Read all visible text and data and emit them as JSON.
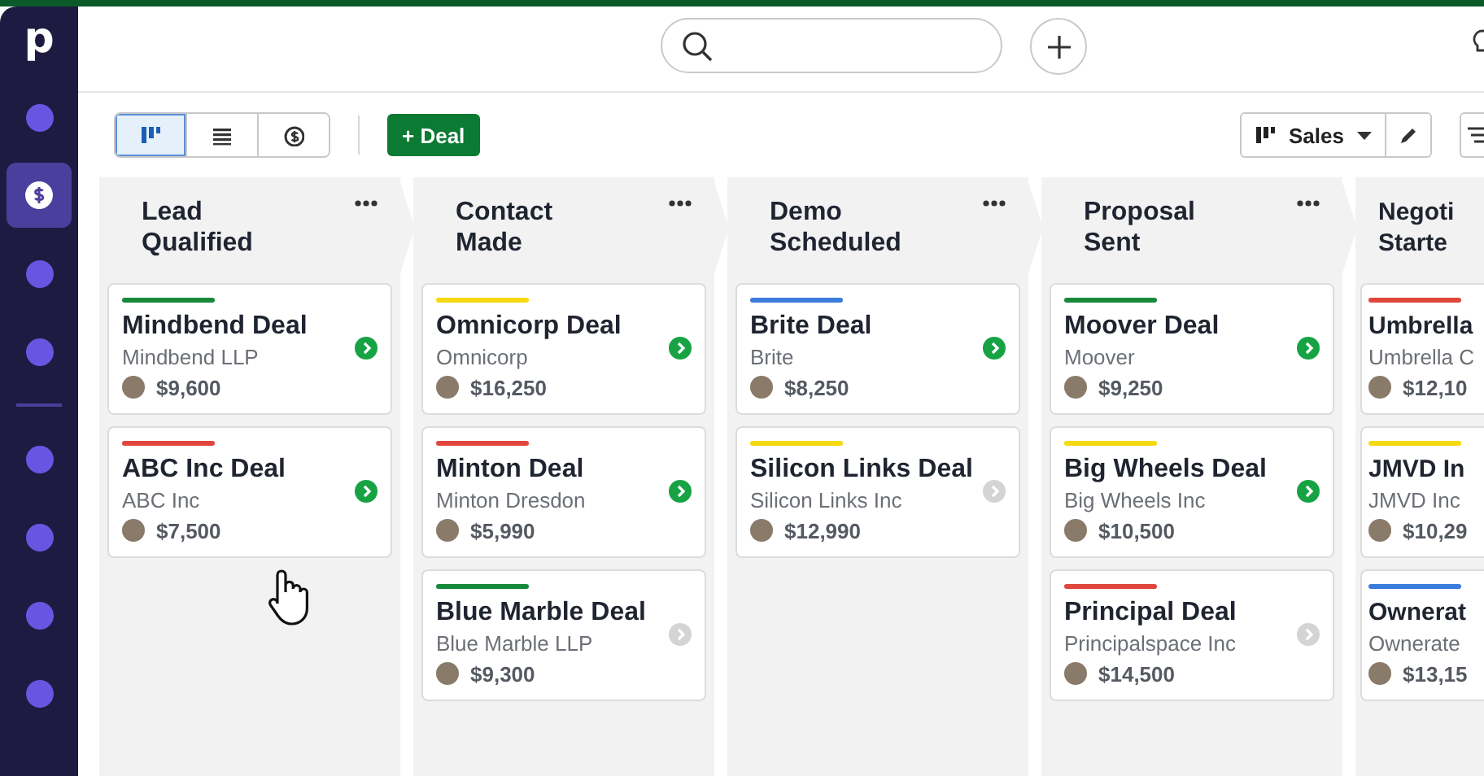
{
  "sidebar": {
    "logo": "p",
    "items": [
      {
        "kind": "dot",
        "selected": false
      },
      {
        "kind": "deals",
        "selected": true
      },
      {
        "kind": "dot",
        "selected": false
      },
      {
        "kind": "dot",
        "selected": false
      },
      {
        "kind": "divider"
      },
      {
        "kind": "dot",
        "selected": false
      },
      {
        "kind": "dot",
        "selected": false
      },
      {
        "kind": "dot",
        "selected": false
      },
      {
        "kind": "dot",
        "selected": false
      }
    ]
  },
  "toolbar": {
    "views": [
      {
        "kind": "pipeline",
        "selected": true
      },
      {
        "kind": "list",
        "selected": false
      },
      {
        "kind": "forecast",
        "selected": false
      }
    ],
    "add_button": "+ Deal",
    "pipeline_select": "Sales"
  },
  "columns": [
    {
      "title": "Lead Qualified",
      "menu": true,
      "cards": [
        {
          "title": "Mindbend Deal",
          "org": "Mindbend LLP",
          "value": "$9,600",
          "color": "#168a3a",
          "active": true
        },
        {
          "title": "ABC Inc Deal",
          "org": "ABC Inc",
          "value": "$7,500",
          "color": "#e0463c",
          "active": true
        }
      ]
    },
    {
      "title": "Contact Made",
      "menu": true,
      "cards": [
        {
          "title": "Omnicorp Deal",
          "org": "Omnicorp",
          "value": "$16,250",
          "color": "#f6d90f",
          "active": true
        },
        {
          "title": "Minton Deal",
          "org": "Minton Dresdon",
          "value": "$5,990",
          "color": "#e0463c",
          "active": true
        },
        {
          "title": "Blue Marble Deal",
          "org": "Blue Marble LLP",
          "value": "$9,300",
          "color": "#168a3a",
          "active": false
        }
      ]
    },
    {
      "title": "Demo Scheduled",
      "menu": true,
      "cards": [
        {
          "title": "Brite Deal",
          "org": "Brite",
          "value": "$8,250",
          "color": "#3b7ddd",
          "active": true
        },
        {
          "title": "Silicon Links Deal",
          "org": "Silicon Links Inc",
          "value": "$12,990",
          "color": "#f6d90f",
          "active": false
        }
      ]
    },
    {
      "title": "Proposal Sent",
      "menu": true,
      "cards": [
        {
          "title": "Moover Deal",
          "org": "Moover",
          "value": "$9,250",
          "color": "#168a3a",
          "active": true
        },
        {
          "title": "Big Wheels Deal",
          "org": "Big Wheels Inc",
          "value": "$10,500",
          "color": "#f6d90f",
          "active": true
        },
        {
          "title": "Principal Deal",
          "org": "Principalspace Inc",
          "value": "$14,500",
          "color": "#e0463c",
          "active": false
        }
      ]
    },
    {
      "title": "Negoti Starte",
      "menu": false,
      "cards": [
        {
          "title": "Umbrella",
          "org": "Umbrella C",
          "value": "$12,10",
          "color": "#e0463c"
        },
        {
          "title": "JMVD In",
          "org": "JMVD Inc",
          "value": "$10,29",
          "color": "#f6d90f"
        },
        {
          "title": "Ownerat",
          "org": "Ownerate",
          "value": "$13,15",
          "color": "#3b7ddd"
        }
      ]
    }
  ]
}
